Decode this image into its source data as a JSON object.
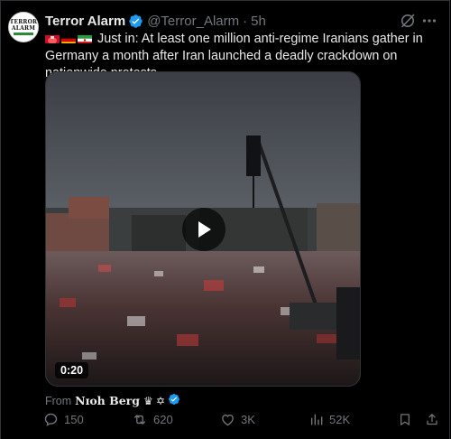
{
  "author": {
    "name": "Terror Alarm",
    "handle": "@Terror_Alarm",
    "separator": "·",
    "time": "5h",
    "avatar_line1": "TERROR",
    "avatar_line2": "ALARM"
  },
  "tweet": {
    "text": "Just in: At least one million anti-regime Iranians gather in Germany a month after Iran launched a deadly crackdown on nationwide protests."
  },
  "video": {
    "duration": "0:20"
  },
  "source": {
    "from_label": "From",
    "name": "Nɪoh Berg",
    "extra": "♛ ✡"
  },
  "actions": {
    "replies": "150",
    "reposts": "620",
    "likes": "3K",
    "views": "52K"
  },
  "colors": {
    "verified": "#1d9bf0",
    "muted": "#71767b",
    "text": "#e7e9ea",
    "background": "#000000"
  },
  "icons": [
    "verified-icon",
    "grok-icon",
    "more-icon",
    "play-icon",
    "reply-icon",
    "repost-icon",
    "like-icon",
    "views-icon",
    "bookmark-icon",
    "share-icon"
  ]
}
